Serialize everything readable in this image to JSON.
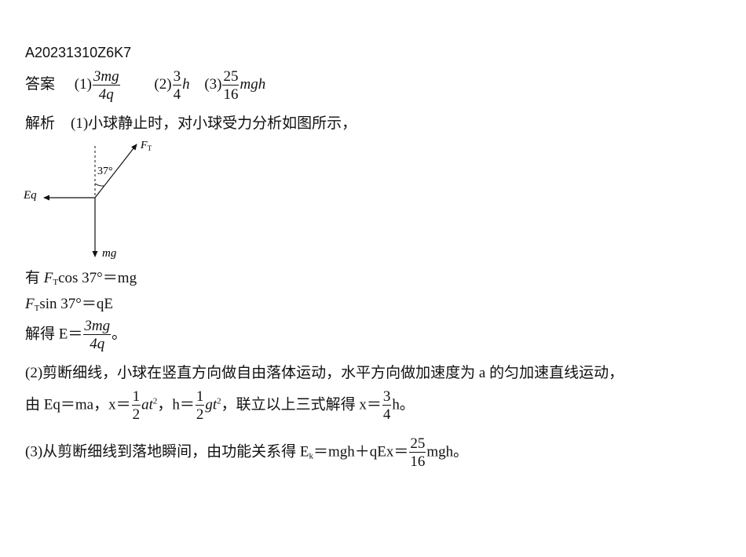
{
  "doc_id": "A20231310Z6K7",
  "answer": {
    "label": "答案",
    "p1": {
      "tag": "(1)",
      "num": "3mg",
      "den": "4q"
    },
    "p2": {
      "tag": "(2)",
      "num": "3",
      "den": "4",
      "tail": "h"
    },
    "p3": {
      "tag": "(3)",
      "num": "25",
      "den": "16",
      "tail": "mgh"
    }
  },
  "analysis": {
    "label": "解析",
    "l1": "(1)小球静止时，对小球受力分析如图所示，",
    "diagram": {
      "ft_label": "F",
      "ft_sub": "T",
      "angle_label": "37°",
      "eq_label": "Eq",
      "mg_label": "mg"
    },
    "eq1": {
      "pre": "有 ",
      "F": "F",
      "sub": "T",
      "rest": "cos 37°＝mg"
    },
    "eq2": {
      "F": "F",
      "sub": "T",
      "rest": "sin 37°＝qE"
    },
    "eq3": {
      "pre": "解得 E＝",
      "num": "3mg",
      "den": "4q",
      "post": "。"
    },
    "p2_l1": "(2)剪断细线，小球在竖直方向做自由落体运动，水平方向做加速度为 a 的匀加速直线运动，",
    "p2_l2": {
      "a": "由 Eq＝ma，x＝",
      "f1_num": "1",
      "f1_den": "2",
      "b": "at",
      "sq1": "2",
      "c": "，h＝",
      "f2_num": "1",
      "f2_den": "2",
      "d": "gt",
      "sq2": "2",
      "e": "，联立以上三式解得 x＝",
      "f3_num": "3",
      "f3_den": "4",
      "f": "h。"
    },
    "p3": {
      "a": "(3)从剪断细线到落地瞬间，由功能关系得 E",
      "sub": "k",
      "b": "＝mgh＋qEx＝",
      "num": "25",
      "den": "16",
      "c": "mgh。"
    }
  }
}
